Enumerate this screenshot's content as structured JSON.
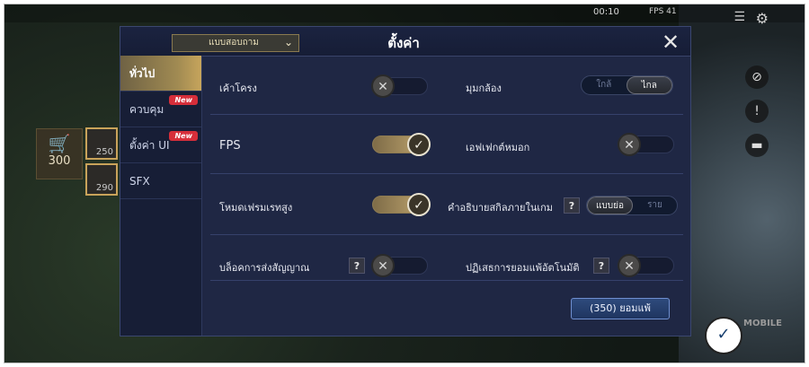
{
  "hud": {
    "time": "00:10",
    "fps": "FPS 41",
    "shop_gold": "300",
    "item_costs": [
      "250",
      "290"
    ]
  },
  "settings": {
    "mode_select": {
      "value": "แบบสอบถาม"
    },
    "title": "ตั้งค่า",
    "sidebar": [
      {
        "label": "ทั่วไป",
        "active": true,
        "badge": ""
      },
      {
        "label": "ควบคุม",
        "active": false,
        "badge": "New"
      },
      {
        "label": "ตั้งค่า UI",
        "active": false,
        "badge": "New"
      },
      {
        "label": "SFX",
        "active": false,
        "badge": ""
      }
    ],
    "rows": {
      "outline": {
        "label": "เค้าโครง",
        "state": "off"
      },
      "camera": {
        "label": "มุมกล้อง",
        "options": [
          "ใกล้",
          "ไกล"
        ],
        "selected": "ไกล"
      },
      "fps": {
        "label": "FPS",
        "state": "on"
      },
      "fog": {
        "label": "เอฟเฟกต์หมอก",
        "state": "off"
      },
      "high_frame": {
        "label": "โหมดเฟรมเรทสูง",
        "state": "on"
      },
      "skill_desc": {
        "label": "คำอธิบายสกิลภายในเกม",
        "help": "?",
        "options": [
          "แบบย่อ",
          "รายละเอียด"
        ],
        "selected": "แบบย่อ"
      },
      "block_signal": {
        "label": "บล็อคการส่งสัญญาณ",
        "help": "?",
        "state": "off"
      },
      "decline_surrender": {
        "label": "ปฏิเสธการยอมแพ้อัตโนมัติ",
        "help": "?",
        "state": "off"
      }
    },
    "surrender_button": "(350) ยอมแพ้",
    "toggle_glyphs": {
      "on": "✓",
      "off": "✕"
    }
  },
  "colors": {
    "panel_bg": "#1f2744",
    "accent_gold": "#c0a56e",
    "button_blue": "#2e4a7c"
  }
}
